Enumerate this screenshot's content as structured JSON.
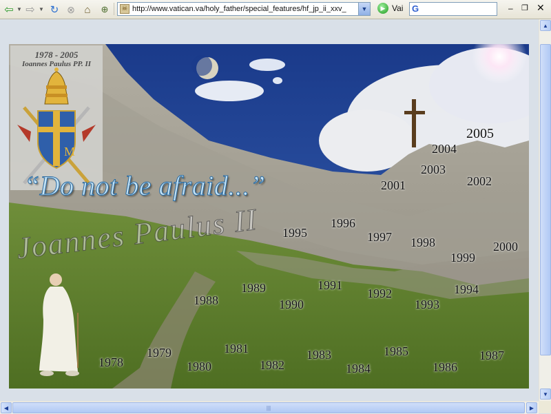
{
  "toolbar": {
    "url": "http://www.vatican.va/holy_father/special_features/hf_jp_ii_xxv_",
    "go_label": "Vai",
    "search_value": "",
    "icons": [
      "back-icon",
      "forward-icon",
      "refresh-icon",
      "stop-icon",
      "home-icon",
      "bookmark-add-icon",
      "page-icon",
      "go-icon",
      "google-icon",
      "minimize-icon",
      "restore-icon",
      "close-icon"
    ]
  },
  "banner": {
    "crest_years": "1978 - 2005",
    "crest_name": "Ioannes Paulus PP. II",
    "motto": "“Do not be afraid...”",
    "signature": "Joannes Paulus II",
    "years": [
      "1978",
      "1979",
      "1980",
      "1981",
      "1982",
      "1983",
      "1984",
      "1985",
      "1986",
      "1987",
      "1988",
      "1989",
      "1990",
      "1991",
      "1992",
      "1993",
      "1994",
      "1995",
      "1996",
      "1997",
      "1998",
      "1999",
      "2000",
      "2001",
      "2002",
      "2003",
      "2004",
      "2005"
    ]
  },
  "colors": {
    "sky": "#1e3f8c",
    "motto": "#c4e3f6",
    "grass": "#5a7d2f"
  }
}
